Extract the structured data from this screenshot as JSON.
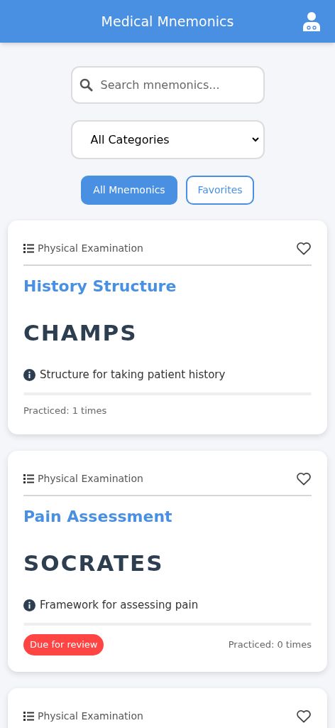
{
  "header": {
    "title": "Medical Mnemonics"
  },
  "search": {
    "placeholder": "Search mnemonics..."
  },
  "category_select": {
    "value": "All Categories"
  },
  "tabs": [
    {
      "label": "All Mnemonics",
      "selected": true
    },
    {
      "label": "Favorites",
      "selected": false
    }
  ],
  "cards": [
    {
      "category": "Physical Examination",
      "favorite": false,
      "title": "History Structure",
      "mnemonic": "CHAMPS",
      "description": "Structure for taking patient history",
      "due": false,
      "practiced": "Practiced: 1 times"
    },
    {
      "category": "Physical Examination",
      "favorite": false,
      "title": "Pain Assessment",
      "mnemonic": "SOCRATES",
      "description": "Framework for assessing pain",
      "due": true,
      "due_label": "Due for review",
      "practiced": "Practiced: 0 times"
    },
    {
      "category": "Physical Examination",
      "favorite": false
    }
  ]
}
